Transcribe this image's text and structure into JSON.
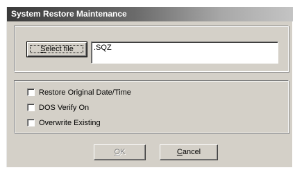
{
  "window": {
    "title": "System Restore Maintenance"
  },
  "file_group": {
    "select_button": {
      "prefix": "",
      "accel": "S",
      "rest": "elect file"
    },
    "file_value": ".SQZ"
  },
  "options": [
    {
      "label": "Restore Original Date/Time",
      "checked": false
    },
    {
      "label": "DOS Verify On",
      "checked": false
    },
    {
      "label": "Overwrite Existing",
      "checked": false
    }
  ],
  "buttons": {
    "ok": {
      "accel": "O",
      "rest": "K",
      "enabled": false
    },
    "cancel": {
      "accel": "C",
      "rest": "ancel",
      "enabled": true
    }
  }
}
